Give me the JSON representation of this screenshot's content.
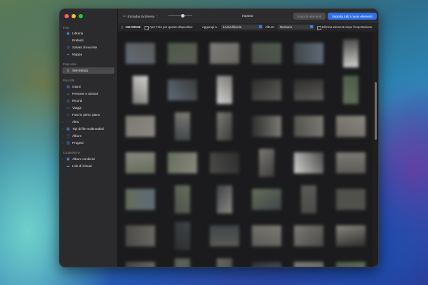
{
  "toolbar": {
    "library_dropdown": "Entradas la libreria",
    "title": "Importa",
    "import_selected": "Importa elementi",
    "import_all": "Importa tutti i nuovi elementi"
  },
  "device_bar": {
    "device": "SM-S901B",
    "open_photos": "Apri Foto per questo dispositivo",
    "add_to_label": "Aggiungi a:",
    "add_to_value": "La tua libreria",
    "album_label": "Album:",
    "album_value": "Nessuno",
    "delete_after": "Elimina elementi dopo l'importazione"
  },
  "sidebar": {
    "sections": [
      {
        "title": "Foto",
        "items": [
          {
            "label": "Libreria",
            "icon": "photo-library-icon"
          },
          {
            "label": "Preferiti",
            "icon": "heart-icon"
          },
          {
            "label": "Salvati di recente",
            "icon": "clock-icon"
          },
          {
            "label": "Mappa",
            "icon": "map-icon"
          }
        ]
      },
      {
        "title": "Dispositivi",
        "items": [
          {
            "label": "SM-S901B",
            "icon": "phone-icon",
            "selected": true
          }
        ]
      },
      {
        "title": "Raccolte",
        "items": [
          {
            "label": "Giorni",
            "icon": "calendar-icon"
          },
          {
            "label": "Persone e animali",
            "icon": "person-icon"
          },
          {
            "label": "Ricordi",
            "icon": "memories-icon"
          },
          {
            "label": "Viaggi",
            "icon": "suitcase-icon"
          },
          {
            "label": "Foto in primo piano",
            "icon": "star-icon"
          },
          {
            "label": "Altro",
            "icon": "more-icon",
            "expandable": true
          },
          {
            "label": "Tipi di file multimediali",
            "icon": "media-types-icon",
            "expandable": true
          },
          {
            "label": "Album",
            "icon": "album-icon",
            "expandable": true
          },
          {
            "label": "Progetti",
            "icon": "projects-icon",
            "expandable": true
          }
        ]
      },
      {
        "title": "Condivisione",
        "items": [
          {
            "label": "Album condivisi",
            "icon": "shared-album-icon",
            "expandable": true
          },
          {
            "label": "Link di iCloud",
            "icon": "icloud-link-icon"
          }
        ]
      }
    ]
  },
  "colors": {
    "accent": "#3d7ff5",
    "sidebar_icon": "#3d96f7",
    "window_bg": "#1f1f1f"
  }
}
